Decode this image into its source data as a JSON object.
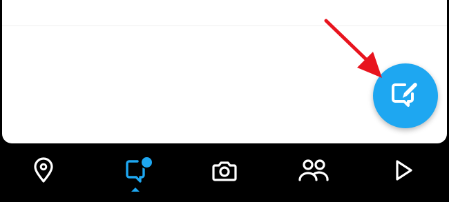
{
  "colors": {
    "accent": "#1ea7f1",
    "annotation_arrow": "#e8141e",
    "nav_background": "#000000",
    "icon_inactive": "#ffffff"
  },
  "fab": {
    "icon": "new-chat-compose-icon"
  },
  "bottom_nav": {
    "items": [
      {
        "id": "map",
        "icon": "map-pin-icon",
        "active": false
      },
      {
        "id": "chat",
        "icon": "chat-bubble-icon",
        "active": true,
        "has_notification_dot": true
      },
      {
        "id": "camera",
        "icon": "camera-icon",
        "active": false
      },
      {
        "id": "stories",
        "icon": "friends-icon",
        "active": false
      },
      {
        "id": "spotlight",
        "icon": "play-icon",
        "active": false
      }
    ]
  }
}
